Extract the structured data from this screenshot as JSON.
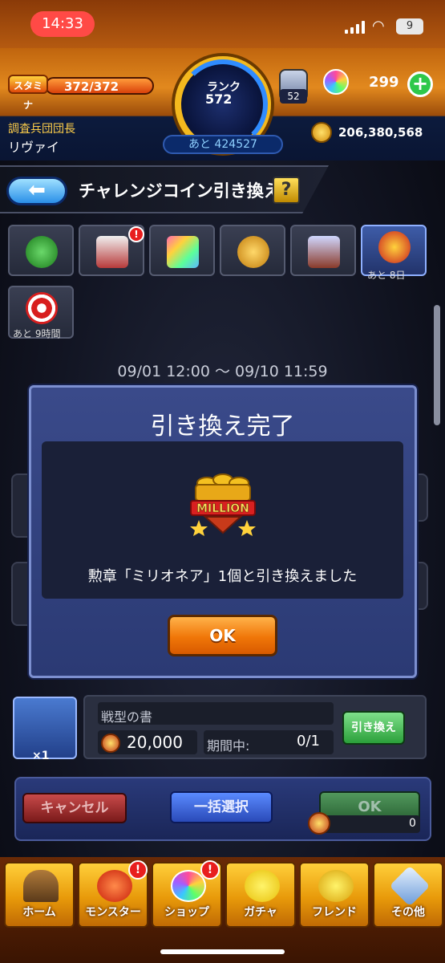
{
  "status_bar": {
    "time": "14:33",
    "battery": "9",
    "wifi_icon": "wifi-icon",
    "signal_icon": "signal-icon"
  },
  "header": {
    "stamina_label": "スタミナ",
    "stamina_value": "372/372",
    "rank_label": "ランク",
    "rank_value": "572",
    "rank_next": "あと 424527",
    "luck_count": "52",
    "orb_count": "299",
    "plus_label": "+",
    "player_title": "調査兵団団長",
    "player_name": "リヴァイ",
    "gold_count": "206,380,568"
  },
  "title_bar": {
    "back_label": "⬅",
    "title": "チャレンジコイン引き換え",
    "help_label": "?"
  },
  "tabs": [
    {
      "name": "tab-clover",
      "icon": "clover-icon",
      "badge": ""
    },
    {
      "name": "tab-egg-card",
      "icon": "egg-card-icon",
      "badge": "!"
    },
    {
      "name": "tab-rainbow-card",
      "icon": "rainbow-card-icon",
      "badge": ""
    },
    {
      "name": "tab-monster",
      "icon": "monster-icon",
      "badge": ""
    },
    {
      "name": "tab-frame",
      "icon": "frame-icon",
      "badge": ""
    },
    {
      "name": "tab-crown-coin",
      "icon": "crown-coin-icon",
      "timer": "あと 8日"
    },
    {
      "name": "tab-target",
      "icon": "target-icon",
      "timer": "あと 9時間"
    }
  ],
  "period": "09/01 12:00 〜 09/10 11:59",
  "modal": {
    "title": "引き換え完了",
    "medal_text": "MILLION",
    "message": "勲章「ミリオネア」1個と引き換えました",
    "ok_label": "OK"
  },
  "item": {
    "name": "戦型の書",
    "count": "×1",
    "price": "20,000",
    "limit_label": "期間中:",
    "limit_value": "0/1",
    "exchange_label": "引き換え"
  },
  "actions": {
    "cancel": "キャンセル",
    "bulk_select": "一括選択",
    "ok": "OK",
    "ok_count": "0"
  },
  "nav": [
    {
      "label": "ホーム",
      "icon": "home-icon"
    },
    {
      "label": "モンスター",
      "icon": "monster-dragon-icon",
      "badge": "!"
    },
    {
      "label": "ショップ",
      "icon": "orb-shop-icon",
      "badge": "!"
    },
    {
      "label": "ガチャ",
      "icon": "gacha-icon"
    },
    {
      "label": "フレンド",
      "icon": "friend-icon"
    },
    {
      "label": "その他",
      "icon": "other-icon"
    }
  ],
  "colors": {
    "accent_orange": "#f07608",
    "panel_blue": "#2b3a74",
    "ok_green": "#2ba03a"
  }
}
